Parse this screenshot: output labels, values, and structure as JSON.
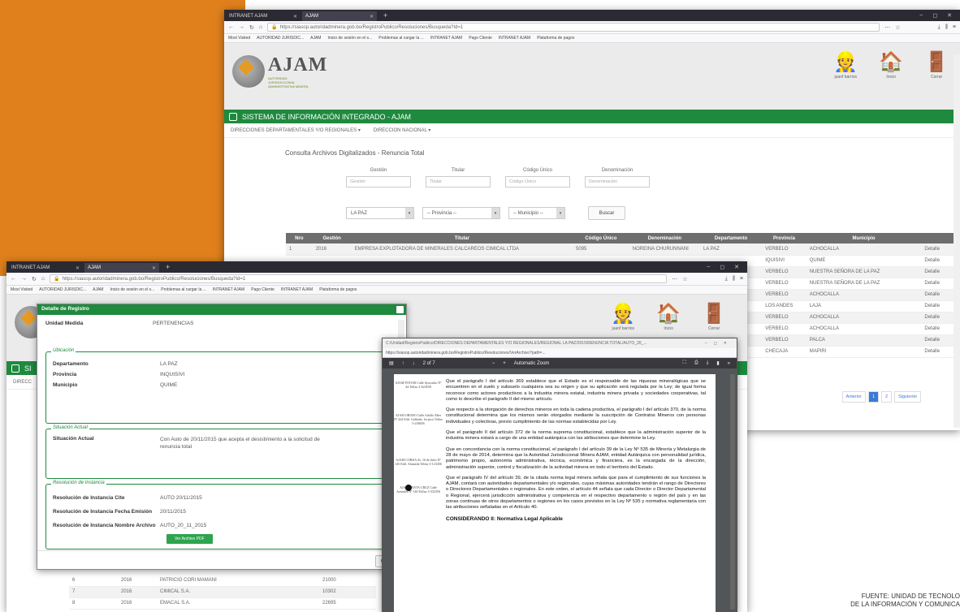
{
  "browser_front": {
    "tabs": [
      {
        "label": "INTRANET AJAM"
      },
      {
        "label": "AJAM"
      }
    ],
    "url": "https://siasop.autoridadminera.gob.bo/RegistroPublico/Resoluciones/Busqueda?Id=1",
    "url_host": "autoridadminera.gob.bo",
    "bookmarks": [
      "Most Visited",
      "AUTORIDAD JURISDIC...",
      "AJAM",
      "Inicio de sesión en el s...",
      "Problemas al cargar la ...",
      "INTRANET AJAM",
      "Pago Cliente",
      "INTRANET AJAM",
      "Plataforma de pagos"
    ]
  },
  "header": {
    "logo_text": "AJAM",
    "logo_sub": "AUTORIDAD JURISDICCIONAL ADMINISTRATIVA MINERA",
    "icons": [
      {
        "icon": "user-icon",
        "label": "juanf barrios"
      },
      {
        "icon": "home-icon",
        "label": "Inicio"
      },
      {
        "icon": "exit-icon",
        "label": "Cerrar"
      }
    ]
  },
  "green_title": "SISTEMA DE INFORMACIÓN INTEGRADO - AJAM",
  "green_title_short": "SI",
  "subnav": [
    "DIRECCIONES DEPARTAMENTALES Y/O REGIONALES ▾",
    "DIRECCION NACIONAL ▾"
  ],
  "subnav_short": "DIRECC",
  "page_title": "Consulta Archivos Digitalizados - Renuncia Total",
  "filters": [
    {
      "label": "Gestión",
      "placeholder": "Gestión"
    },
    {
      "label": "Titular",
      "placeholder": "Titular"
    },
    {
      "label": "Código Único",
      "placeholder": "Código Único"
    },
    {
      "label": "Denominación",
      "placeholder": "Denominación"
    }
  ],
  "selects": {
    "departamento": "LA PAZ",
    "provincia": "-- Provincia --",
    "municipio": "-- Municipio --"
  },
  "buscar": "Buscar",
  "table": {
    "headers": [
      "Nro",
      "Gestión",
      "Titular",
      "Código Único",
      "Denominación",
      "Departamento",
      "Provincia",
      "Municipio",
      ""
    ],
    "first_row": [
      "1",
      "2016",
      "EMPRESA EXPLOTADORA DE MINERALES CALCAREOS CIMICAL LTDA",
      "5095",
      "NOREINA CHURUNNANI",
      "LA PAZ",
      "VERBELO",
      "ACHOCALLA",
      "Detalle"
    ],
    "partial_rows": [
      {
        "prov": "IQUISIVI",
        "mun": "QUIME",
        "link": "Detalle"
      },
      {
        "prov": "VERBELO",
        "mun": "NUESTRA SEÑORA DE LA PAZ",
        "link": "Detalle"
      },
      {
        "prov": "VERBELO",
        "mun": "NUESTRA SEÑORA DE LA PAZ",
        "link": "Detalle"
      },
      {
        "prov": "VERBELO",
        "mun": "ACHOCALLA",
        "link": "Detalle"
      },
      {
        "prov": "LOS ANDES",
        "mun": "LAJA",
        "link": "Detalle"
      },
      {
        "prov": "VERBELO",
        "mun": "ACHOCALLA",
        "link": "Detalle"
      },
      {
        "prov": "VERBELO",
        "mun": "ACHOCALLA",
        "link": "Detalle"
      },
      {
        "prov": "VERBELO",
        "mun": "PALCA",
        "link": "Detalle"
      },
      {
        "prov": "CHECAJA",
        "mun": "MAPIRI",
        "link": "Detalle"
      }
    ],
    "bottom_rows": [
      {
        "nro": "6",
        "year": "2016",
        "name": "PATRICIO CORI MAMANI",
        "code": "21000"
      },
      {
        "nro": "7",
        "year": "2016",
        "name": "CIMICAL S.A.",
        "code": "10302"
      },
      {
        "nro": "8",
        "year": "2016",
        "name": "EMACAL S.A.",
        "code": "22695"
      }
    ]
  },
  "pager": {
    "prev": "Anterior",
    "pages": [
      "1",
      "2"
    ],
    "next": "Siguiente"
  },
  "modal": {
    "title": "Detalle de Registro",
    "unidad": {
      "k": "Unidad Medida",
      "v": "PERTENENCIAS"
    },
    "ubicacion": {
      "legend": "Ubicación",
      "rows": [
        {
          "k": "Departamento",
          "v": "LA PAZ"
        },
        {
          "k": "Provincia",
          "v": "INQUISIVI"
        },
        {
          "k": "Municipio",
          "v": "QUIME"
        }
      ]
    },
    "situacion": {
      "legend": "Situación Actual",
      "k": "Situación Actual",
      "v": "Con Auto de 20/11/2015 que acepta el desistimiento a la solicitud de renuncia total"
    },
    "resolucion": {
      "legend": "Resolución de Instancia",
      "rows": [
        {
          "k": "Resolución de Instancia Cite",
          "v": "AUTO 20/11/2015"
        },
        {
          "k": "Resolución de Instancia Fecha Emisión",
          "v": "20/11/2015"
        },
        {
          "k": "Resolución de Instancia Nombre Archivo",
          "v": "AUTO_20_11_2015"
        }
      ]
    },
    "pdf_button": "Ver Archivo PDF",
    "close": "Cerrar"
  },
  "pdf": {
    "title": "C:/Unidad/RegistroPublico/DIRECCIONES DEPARTAMENTALES Y/O REGIONALES/REGIONAL LA PAZ/2015/RENUNCIA TOTAL/AUTO_20_...",
    "url": "https://siasop.autoridadminera.gob.bo/RegistroPublico/Resoluciones/VerArchivo?path=...",
    "page_info": "2  of 7",
    "zoom": "Automatic Zoom",
    "margin": [
      "AJAM POTOSI Calle Ayacucho Nº 44 Telfax 2-624558",
      "AJAM ORURO Calle Adolfo Mier Nº 424 Edif. Gallardo 1er piso Telfax 5-236656",
      "AJAM COBIJA Av. 16 de Julio Nº 145 Edif. Alameda Telfax 3-123456",
      "AJAM SANTA CRUZ Calle Arenales Nº 146 Telfax 3-332356"
    ],
    "paragraphs": [
      "Que el parágrafo I del artículo 369 establece que el Estado es el responsable de las riquezas mineralógicas que se encuentren en el suelo y subsuelo cualquiera sea su origen y que su aplicación será regulada por la Ley; de igual forma reconoce como actores productivos a la industria minera estatal, industria minera privada y sociedades cooperativas, tal como lo describe el parágrafo II del mismo artículo.",
      "Que respecto a la otorgación de derechos mineros en toda la cadena productiva, el parágrafo I del artículo 370, de la norma constitucional determina que los mismos serán otorgados mediante la suscripción de Contratos Mineros con personas individuales y colectivas, previo cumplimiento de las normas establecidas por Ley.",
      "Que el parágrafo II del artículo 372 de la norma suprema constitucional, establece que la administración superior de la industria minera estará a cargo de una entidad autárquica con las atribuciones que determine la Ley.",
      "Que en concordancia con la norma constitucional, el parágrafo I del artículo 39 de la Ley Nº 535 de Minería y Metalurgia de 28 de mayo de 2014, determina que la Autoridad Jurisdiccional Minera AJAM, entidad Autárquica con personalidad jurídica, patrimonio propio, autonomía administrativa, técnica, económica y financiera, es la encargada de la dirección, administración superior, control y fiscalización de la actividad minera en todo el territorio del Estado.",
      "Que el parágrafo IV del artículo 39, de la citada norma legal minera señala que para el cumplimiento de sus funciones la AJAM, contará con autoridades departamentales y/o regionales, cuyas máximas autoridades tendrán el rango de Directores o Directores Departamentales o regionales. En este orden, el artículo 44 señala que cada Director o Director Departamental o Regional, ejercerá jurisdicción administrativa y competencia en el respectivo departamento o región del país y en las zonas continuas de otros departamentos o regiones en los casos previstos en la Ley Nº 535 y normativa reglamentaria con las atribuciones señaladas en el Artículo 40."
    ],
    "heading": "CONSIDERANDO II: Normativa Legal Aplicable"
  },
  "footnote": {
    "line1": "FUENTE: UNIDAD DE TECNOLO",
    "line2": "DE LA INFORMACIÓN Y COMUNICA"
  },
  "colors": {
    "accent_orange": "#e0801c",
    "ajam_green": "#1e8a3e",
    "link_blue": "#3a7bd5"
  }
}
